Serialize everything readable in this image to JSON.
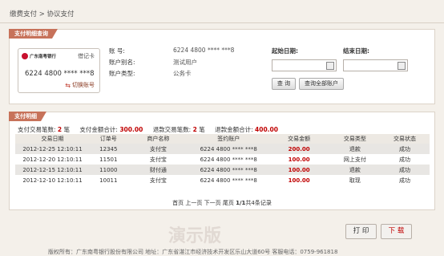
{
  "breadcrumb": "缴费支付 > 协议支付",
  "panel1": {
    "title": "支付明细查询",
    "card": {
      "bank": "广东南粤银行",
      "type": "借记卡",
      "number": "6224 4800 **** ***8",
      "switch_label": "切换账号"
    },
    "info": {
      "account_label": "账      号:",
      "account_value": "6224 4800 **** ***8",
      "alias_label": "账户别名:",
      "alias_value": "测试用户",
      "type_label": "账户类型:",
      "type_value": "公务卡"
    },
    "start_date_label": "起始日期:",
    "end_date_label": "结束日期:",
    "query_button": "查 询",
    "query_all_button": "查询全部账户"
  },
  "panel2": {
    "title": "支付明细",
    "summary": {
      "pay_count_label": "支付交易笔数:",
      "pay_count": "2",
      "pay_count_unit": "笔",
      "pay_total_label": "支付金额合计:",
      "pay_total": "300.00",
      "refund_count_label": "退款交易笔数:",
      "refund_count": "2",
      "refund_count_unit": "笔",
      "refund_total_label": "退款金额合计:",
      "refund_total": "400.00"
    },
    "columns": [
      "交易日期",
      "订单号",
      "商户名称",
      "签约账户",
      "交易金额",
      "交易类型",
      "交易状态"
    ],
    "rows": [
      [
        "2012-12-25 12:10:11",
        "12345",
        "支付宝",
        "6224 4800 **** ***8",
        "200.00",
        "退款",
        "成功"
      ],
      [
        "2012-12-20 12:10:11",
        "11501",
        "支付宝",
        "6224 4800 **** ***8",
        "100.00",
        "网上支付",
        "成功"
      ],
      [
        "2012-12-15 12:10:11",
        "11000",
        "财付通",
        "6224 4800 **** ***8",
        "100.00",
        "退款",
        "成功"
      ],
      [
        "2012-12-10 12:10:11",
        "10011",
        "支付宝",
        "6224 4800 **** ***8",
        "100.00",
        "取现",
        "成功"
      ]
    ],
    "pager": {
      "first": "首页",
      "prev": "上一页",
      "next": "下一页",
      "last": "尾页",
      "page": "1/1",
      "total": "共4条记录"
    }
  },
  "footer_buttons": {
    "print": "打 印",
    "download": "下 载"
  },
  "footer": "版权所有：广东南粤银行股份有限公司   地址：广东省湛江市经济技术开发区乐山大道60号   客服电话：0759-961818",
  "watermark": "演示版"
}
